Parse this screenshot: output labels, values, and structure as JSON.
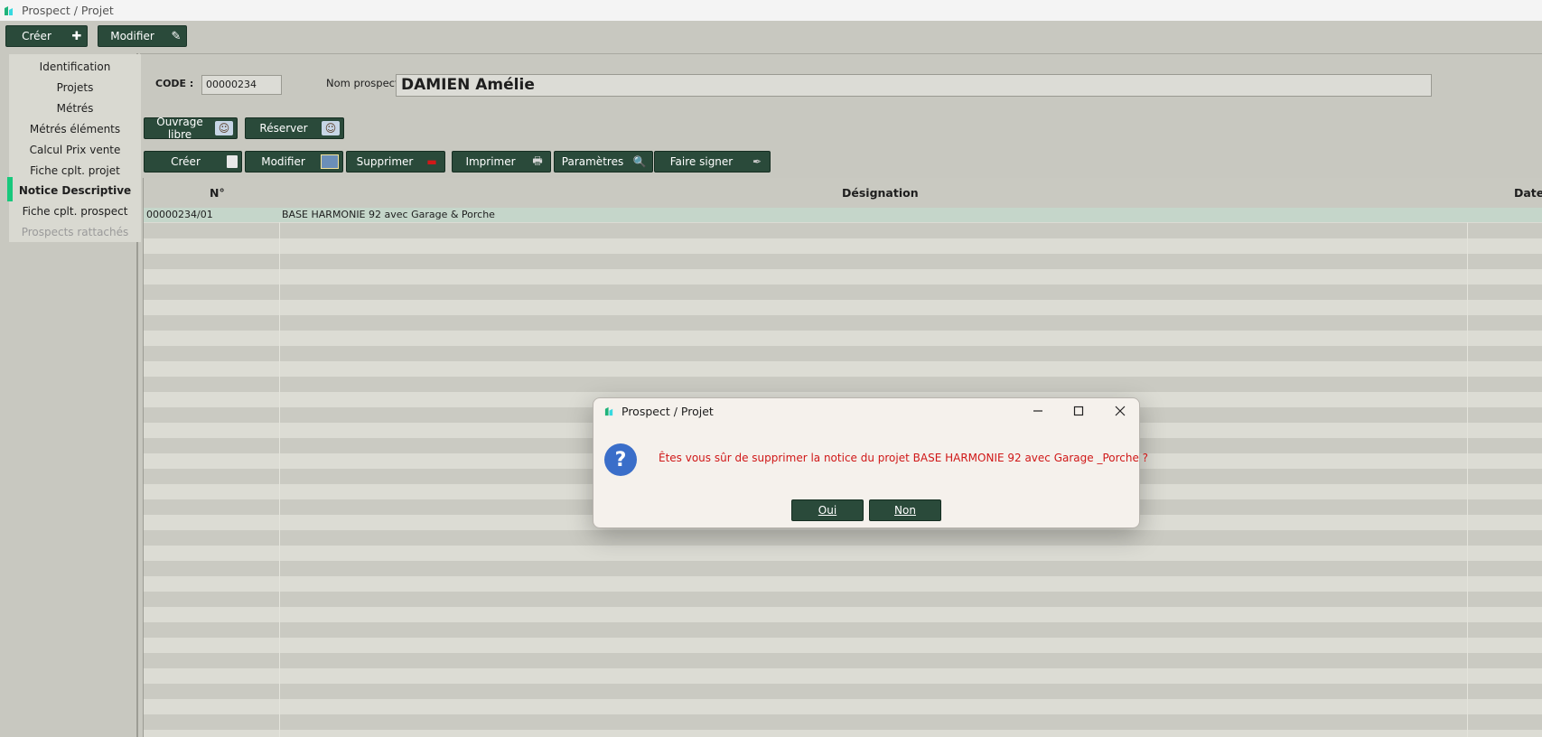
{
  "window": {
    "title": "Prospect / Projet"
  },
  "toolbar": {
    "create_label": "Créer",
    "edit_label": "Modifier"
  },
  "sidebar": {
    "items": [
      {
        "label": "Identification",
        "state": "normal"
      },
      {
        "label": "Projets",
        "state": "normal"
      },
      {
        "label": "Métrés",
        "state": "normal"
      },
      {
        "label": "Métrés éléments",
        "state": "normal"
      },
      {
        "label": "Calcul Prix vente",
        "state": "normal"
      },
      {
        "label": "Fiche cplt. projet",
        "state": "normal"
      },
      {
        "label": "Notice Descriptive",
        "state": "active"
      },
      {
        "label": "Fiche cplt. prospect",
        "state": "normal"
      },
      {
        "label": "Prospects rattachés",
        "state": "disabled"
      }
    ],
    "active_color": "#18c87c"
  },
  "form": {
    "code_label": "CODE :",
    "code_value": "00000234",
    "nom_label": "Nom prospect :",
    "nom_value": "DAMIEN Amélie"
  },
  "actions_top": {
    "ouvrage_label": "Ouvrage libre",
    "reserver_label": "Réserver"
  },
  "actions_grid": {
    "create_label": "Créer",
    "edit_label": "Modifier",
    "delete_label": "Supprimer",
    "print_label": "Imprimer",
    "params_label": "Paramètres",
    "sign_label": "Faire signer"
  },
  "table": {
    "columns": [
      "N°",
      "Désignation",
      "Date"
    ],
    "rows": [
      {
        "num": "00000234/01",
        "designation": "BASE HARMONIE 92 avec Garage & Porche"
      }
    ]
  },
  "dialog": {
    "title": "Prospect / Projet",
    "icon": "question-icon",
    "message": "Êtes vous sûr de supprimer la notice du projet BASE HARMONIE 92 avec Garage _Porche ?",
    "yes_label": "Oui",
    "no_label": "Non"
  },
  "colors": {
    "button_bg": "#2a4a3a",
    "background": "#c8c8c0",
    "message_color": "#d01818",
    "question_icon": "#3a6ec9"
  }
}
